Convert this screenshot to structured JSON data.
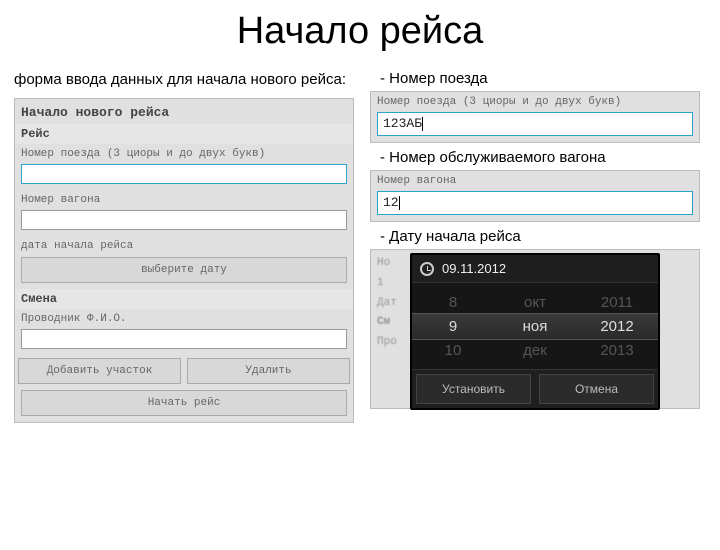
{
  "title": "Начало рейса",
  "left": {
    "desc": "форма ввода данных для начала нового рейса:",
    "form": {
      "header": "Начало нового рейса",
      "section_trip": "Рейс",
      "train_label": "Номер поезда (3 циоры и до двух букв)",
      "wagon_label": "Номер вагона",
      "date_label": "дата начала рейса",
      "date_btn": "выберите дату",
      "section_shift": "Смена",
      "fio_label": "Проводник Ф.И.О.",
      "add_btn": "Добавить участок",
      "del_btn": "Удалить",
      "start_btn": "Начать рейс"
    }
  },
  "right": {
    "sec1_label": "- Номер поезда",
    "train_field_label": "Номер поезда (3 циоры и до двух букв)",
    "train_value": "123АБ",
    "sec2_label": "- Номер обслуживаемого вагона",
    "wagon_field_label": "Номер вагона",
    "wagon_value": "12",
    "sec3_label": "- Дату начала рейса",
    "bg_lines": {
      "a": "Но",
      "b": "1",
      "c": "Дат",
      "d": "См",
      "e": "Про"
    },
    "dp": {
      "date_text": "09.11.2012",
      "day_prev": "8",
      "day_sel": "9",
      "day_next": "10",
      "mon_prev": "окт",
      "mon_sel": "ноя",
      "mon_next": "дек",
      "yr_prev": "2011",
      "yr_sel": "2012",
      "yr_next": "2013",
      "set_btn": "Установить",
      "cancel_btn": "Отмена"
    }
  }
}
